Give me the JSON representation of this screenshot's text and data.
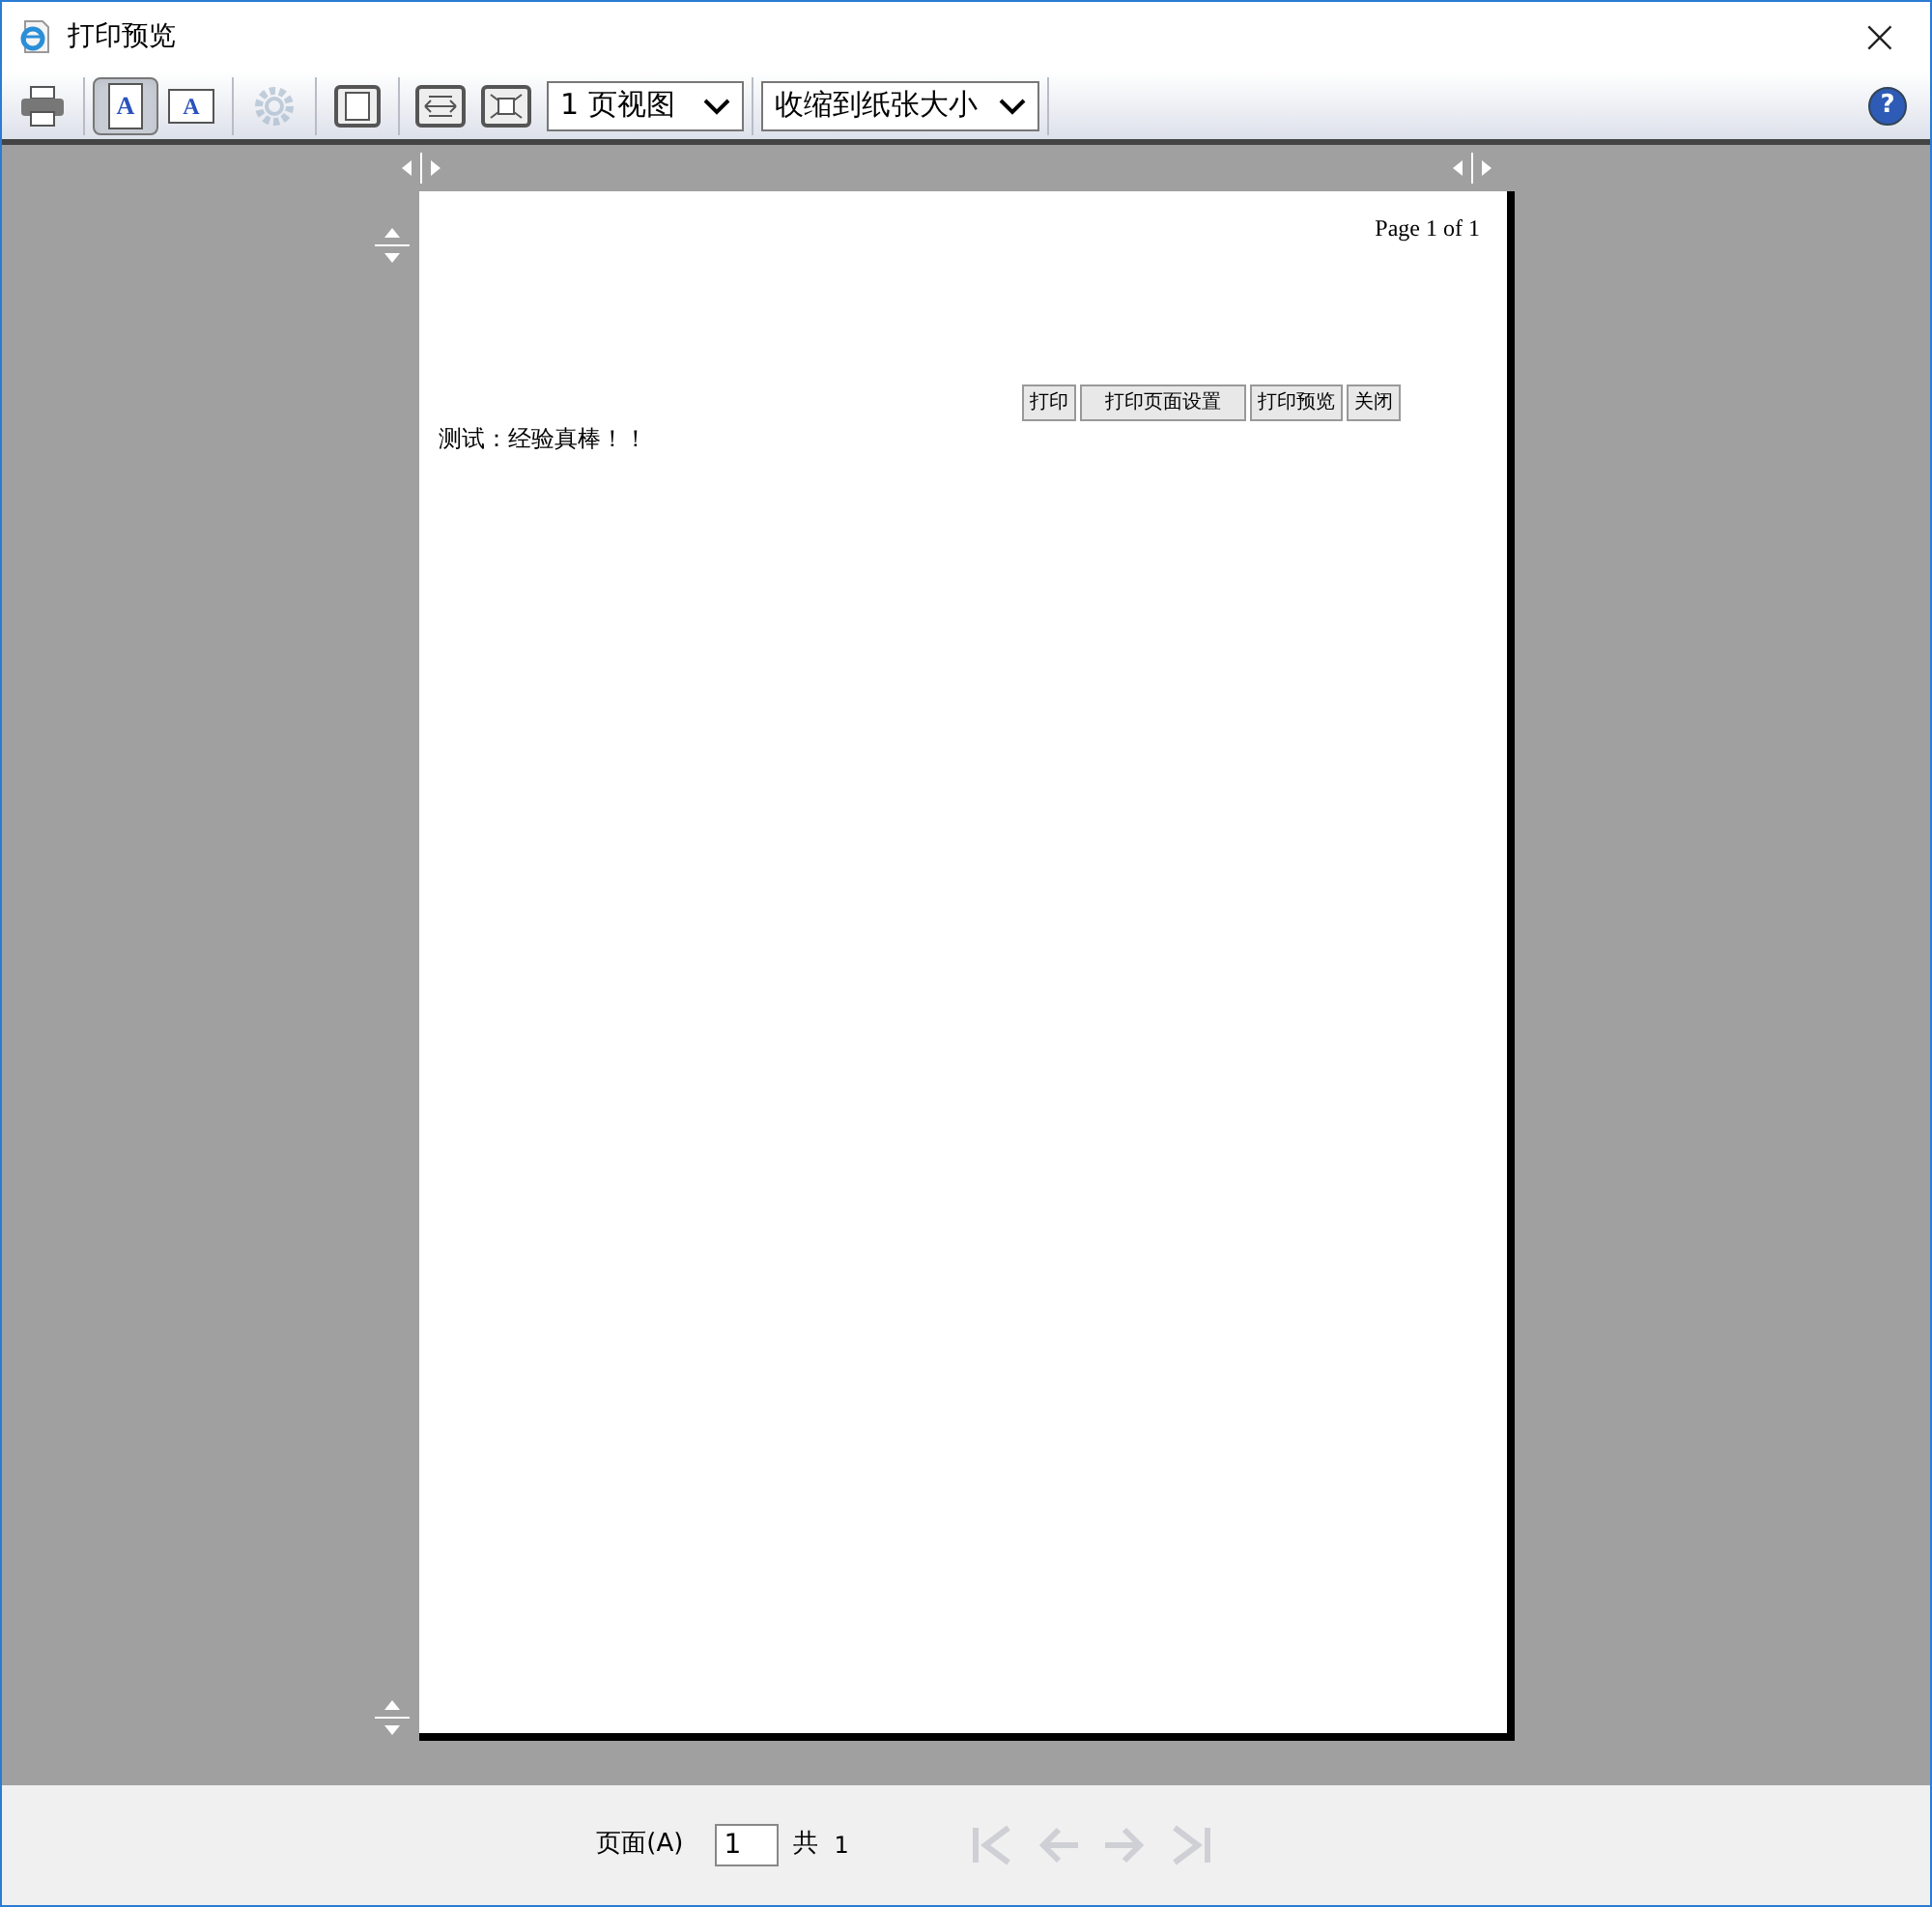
{
  "window": {
    "title": "打印预览",
    "close": "×"
  },
  "toolbar": {
    "items": [
      {
        "kind": "print",
        "selected": false,
        "disabled": false
      },
      {
        "kind": "portrait",
        "glyph": "A",
        "selected": true,
        "disabled": false
      },
      {
        "kind": "landscape",
        "glyph": "A",
        "selected": false,
        "disabled": false
      },
      {
        "kind": "settings",
        "selected": false,
        "disabled": true
      },
      {
        "kind": "headers",
        "selected": false,
        "disabled": false
      },
      {
        "kind": "width",
        "selected": false,
        "disabled": false
      },
      {
        "kind": "whole",
        "selected": false,
        "disabled": false
      }
    ],
    "view_select": "1 页视图",
    "scale_select": "收缩到纸张大小",
    "help": "?"
  },
  "page": {
    "header": "Page 1 of 1",
    "buttons": [
      "打印",
      "打印页面设置",
      "打印预览",
      "关闭"
    ],
    "body_text": "测试：经验真棒！！"
  },
  "footer": {
    "page_label": "页面(A)",
    "page_value": "1",
    "total_label": "共",
    "total": "1",
    "nav": [
      {
        "kind": "first",
        "disabled": true
      },
      {
        "kind": "prev",
        "disabled": true
      },
      {
        "kind": "next",
        "disabled": true
      },
      {
        "kind": "last",
        "disabled": true
      }
    ]
  }
}
